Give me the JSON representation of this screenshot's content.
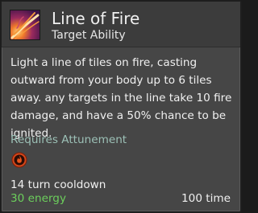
{
  "ability": {
    "name": "Line of Fire",
    "type": "Target Ability",
    "icon": "line-of-fire-icon",
    "description": "Light a line of tiles on fire, casting outward from your body up to 6 tiles away. any targets in the line take 10 fire damage, and have a 50% chance to be ignited.",
    "requirement": "Requires Attunement",
    "requirement_icon": "fire-attunement-icon",
    "cooldown": "14 turn cooldown",
    "energy": "30 energy",
    "time": "100 time"
  },
  "colors": {
    "panel_bg": "#464646",
    "header_bg": "#3c3c3c",
    "text": "#f0f0f0",
    "requirement_text": "#9cc0b6",
    "energy_text": "#6ccf5c",
    "fire": "#e8551c"
  }
}
